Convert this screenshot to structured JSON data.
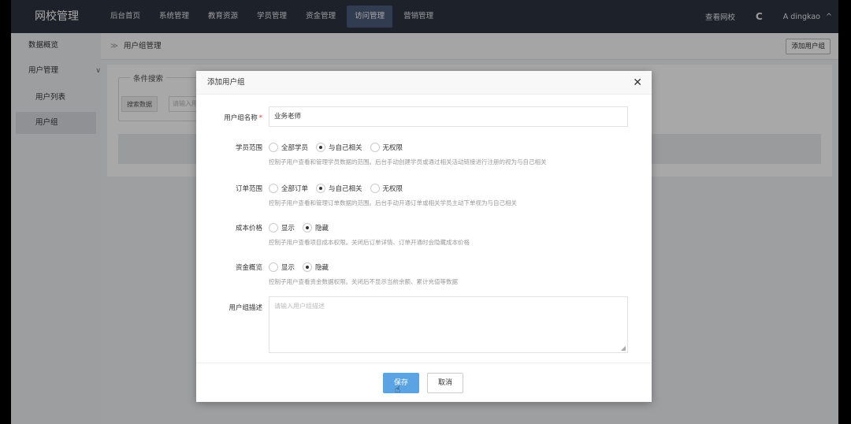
{
  "brand": "网校管理",
  "nav": {
    "items": [
      "后台首页",
      "系统管理",
      "教育资源",
      "学员管理",
      "资金管理",
      "访问管理",
      "营销管理"
    ],
    "active_index": 5
  },
  "topbar": {
    "view_school": "查看网校",
    "refresh_icon": "refresh-icon",
    "user_icon": "user-icon",
    "username": "dingkao",
    "chevron_icon": "chevron-up-icon"
  },
  "sidebar": {
    "overview": "数据概览",
    "user_mgmt": "用户管理",
    "user_list": "用户列表",
    "user_group": "用户组"
  },
  "breadcrumb": {
    "separator": "≫",
    "current": "用户组管理"
  },
  "add_group_button": "添加用户组",
  "filter": {
    "legend": "条件搜索",
    "label": "搜索数据",
    "placeholder": "请输入用"
  },
  "modal": {
    "title": "添加用户组",
    "name_label": "用户组名称",
    "required_mark": "*",
    "name_value": "业务老师",
    "student_scope": {
      "label": "学员范围",
      "options": [
        "全部学员",
        "与自己相关",
        "无权限"
      ],
      "selected": 1,
      "help": "控制子用户查看和管理学员数据的范围。后台手动创建学员或通过相关活动链接进行注册的视为与自己相关"
    },
    "order_scope": {
      "label": "订单范围",
      "options": [
        "全部订单",
        "与自己相关",
        "无权限"
      ],
      "selected": 1,
      "help": "控制子用户查看和管理订单数据的范围。后台手动开通订单或相关学员主动下单视为与自己相关"
    },
    "cost_price": {
      "label": "成本价格",
      "options": [
        "显示",
        "隐藏"
      ],
      "selected": 1,
      "help": "控制子用户查看项目成本权限。关闭后订单详情、订单开通时会隐藏成本价格"
    },
    "fund_overview": {
      "label": "资金概览",
      "options": [
        "显示",
        "隐藏"
      ],
      "selected": 1,
      "help": "控制子用户查看资金数据权限。关闭后不显示当前余额、累计充值等数据"
    },
    "desc": {
      "label": "用户组描述",
      "placeholder": "请输入用户组描述"
    },
    "save": "保存",
    "cancel": "取消"
  },
  "colors": {
    "topbar": "#2d3441",
    "nav_active": "#4c5b7a",
    "primary": "#5aa4e4",
    "required": "#e4393c"
  }
}
